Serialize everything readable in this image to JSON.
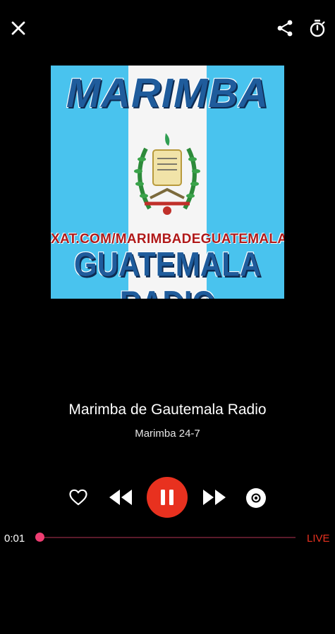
{
  "header": {
    "close_icon": "close-icon",
    "share_icon": "share-icon",
    "timer_icon": "sleep-timer-icon"
  },
  "artwork": {
    "title": "MARIMBA",
    "url_text": "XAT.COM/MARIMBADEGUATEMALA",
    "subtitle": "GUATEMALA RADIO",
    "colors": {
      "sky_blue": "#49c3ee",
      "white": "#f5f5f5",
      "text_blue": "#1f5c9c",
      "url_red": "#b01919"
    }
  },
  "station": {
    "title": "Marimba de Gautemala Radio",
    "subtitle": "Marimba 24-7"
  },
  "controls": {
    "favorite_icon": "heart-icon",
    "rewind_icon": "rewind-icon",
    "pause_icon": "pause-icon",
    "fast_forward_icon": "fast-forward-icon",
    "record_icon": "record-icon",
    "accent_color": "#e8311f"
  },
  "progress": {
    "current_time": "0:01",
    "live_label": "LIVE",
    "thumb_color": "#ee3d72"
  }
}
